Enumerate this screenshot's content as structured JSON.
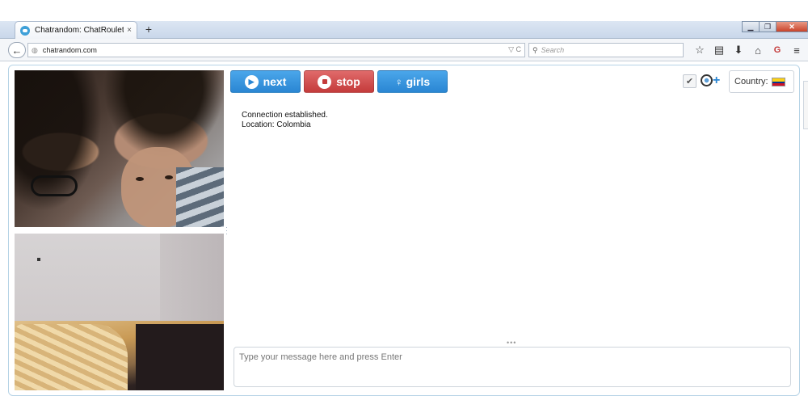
{
  "browser": {
    "tab_title": "Chatrandom: ChatRoulette...",
    "tab_close": "×",
    "new_tab": "+",
    "url": "chatrandom.com",
    "url_right": "▽ C",
    "search_placeholder": "Search",
    "controls": {
      "minimize": "▁",
      "restore": "❐",
      "close": "✕"
    },
    "toolbar_icons": [
      "star-icon",
      "clipboard-icon",
      "download-icon",
      "home-icon",
      "addon-icon",
      "menu-icon"
    ],
    "toolbar_glyphs": [
      "☆",
      "▤",
      "⬇",
      "⌂",
      "G",
      "≡"
    ]
  },
  "controls": {
    "next_label": "next",
    "stop_label": "stop",
    "girls_label": "girls",
    "country_label": "Country:",
    "check_glyph": "✔",
    "add_glyph": "+"
  },
  "colors": {
    "next": "#2a86d3",
    "stop": "#c43b3b",
    "girls": "#2a86d3",
    "page_border": "#b6d3e6"
  },
  "messages": [
    "Connection established.",
    "Location: Colombia"
  ],
  "chat": {
    "placeholder": "Type your message here and press Enter",
    "divider": "•••"
  }
}
